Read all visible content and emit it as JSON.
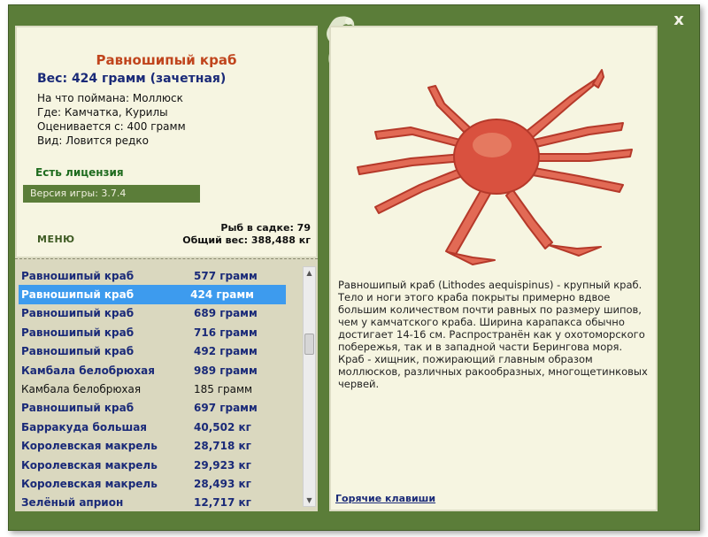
{
  "window": {
    "close_label": "x"
  },
  "fish": {
    "title": "Равношипый краб",
    "weight": "Вес: 424 грамм (зачетная)",
    "info_lines": [
      "На что поймана: Моллюск",
      "Где: Камчатка, Курилы",
      "Оценивается с: 400 грамм",
      "Вид: Ловится редко"
    ],
    "license": "Есть лицензия",
    "version": "Версия игры: 3.7.4"
  },
  "menu": {
    "label": "МЕНЮ"
  },
  "stats": {
    "count": "Рыб в садке: 79",
    "total_weight": "Общий вес: 388,488 кг"
  },
  "catch_list": [
    {
      "name": "Равношипый краб",
      "weight": "577 грамм",
      "style": "bold"
    },
    {
      "name": "Равношипый краб",
      "weight": "424 грамм",
      "style": "selected"
    },
    {
      "name": "Равношипый краб",
      "weight": "689 грамм",
      "style": "bold"
    },
    {
      "name": "Равношипый краб",
      "weight": "716 грамм",
      "style": "bold"
    },
    {
      "name": "Равношипый краб",
      "weight": "492 грамм",
      "style": "bold"
    },
    {
      "name": "Камбала белобрюхая",
      "weight": "989 грамм",
      "style": "bold"
    },
    {
      "name": "Камбала белобрюхая",
      "weight": "185 грамм",
      "style": "normal"
    },
    {
      "name": "Равношипый краб",
      "weight": "697 грамм",
      "style": "bold"
    },
    {
      "name": "Барракуда большая",
      "weight": "40,502 кг",
      "style": "bold"
    },
    {
      "name": "Королевская макрель",
      "weight": "28,718 кг",
      "style": "bold"
    },
    {
      "name": "Королевская макрель",
      "weight": "29,923 кг",
      "style": "bold"
    },
    {
      "name": "Королевская макрель",
      "weight": "28,493 кг",
      "style": "bold"
    },
    {
      "name": "Зелёный априон",
      "weight": "12,717 кг",
      "style": "bold"
    }
  ],
  "description": "Равношипый краб (Lithodes aequispinus) - крупный краб. Тело и ноги этого краба покрыты примерно вдвое большим количеством почти равных по размеру шипов, чем у камчатского краба. Ширина карапакса обычно достигает 14-16 см. Распространён как у охотоморского побережья, так и в западной части Берингова моря. Краб - хищник, пожирающий главным образом моллюсков, различных ракообразных, многощетинковых червей.",
  "hotkeys": {
    "label": "Горячие клавиши"
  },
  "colors": {
    "frame": "#5b7d39",
    "panel": "#f6f5e1",
    "list_bg": "#dad8bf",
    "title": "#c0451d",
    "text_blue": "#1a2a78",
    "selected": "#3d9bee",
    "crab": "#d9513f"
  }
}
